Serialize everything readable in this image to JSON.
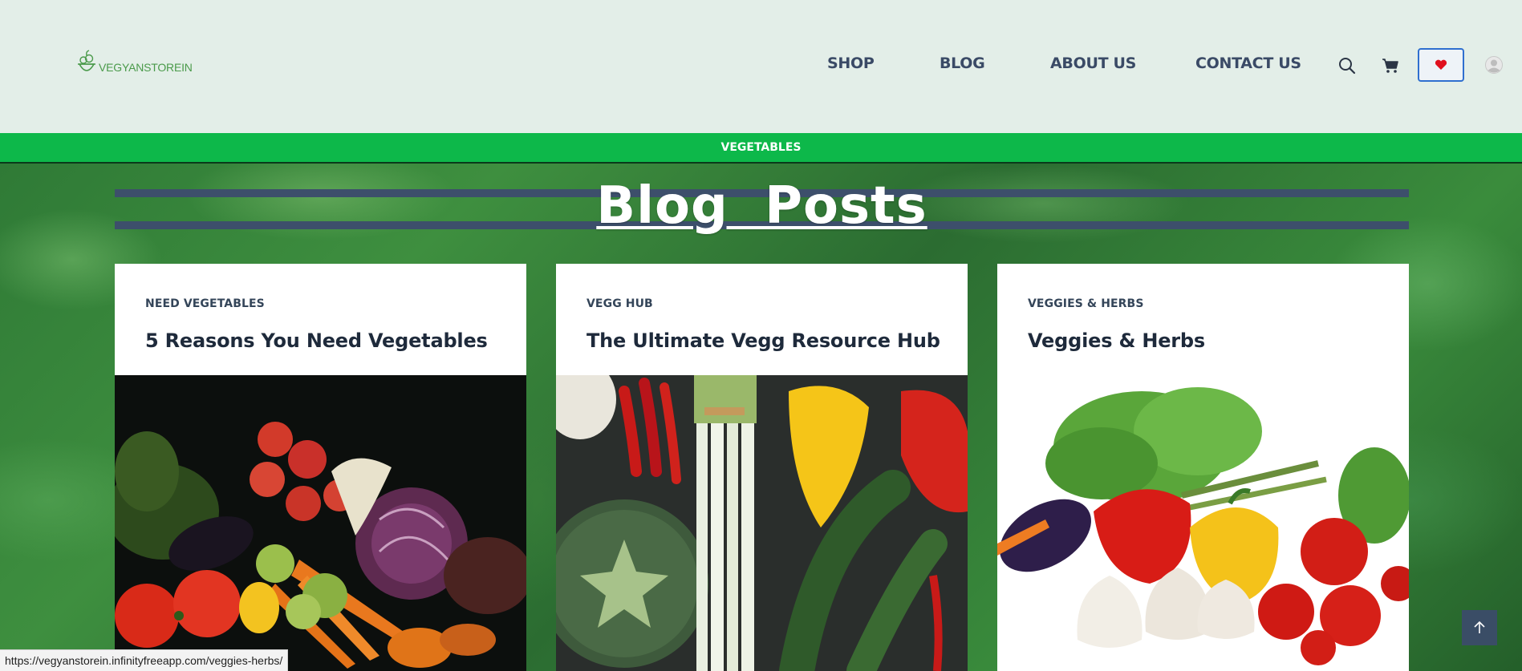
{
  "header": {
    "logo_text": "VEGYANSTOREIN",
    "nav": [
      {
        "label": "SHOP"
      },
      {
        "label": "BLOG"
      },
      {
        "label": "ABOUT US"
      },
      {
        "label": "CONTACT US"
      }
    ],
    "icons": [
      "search-icon",
      "cart-icon",
      "heart-icon",
      "user-avatar-icon"
    ]
  },
  "category_bar": {
    "label": "VEGETABLES"
  },
  "hero": {
    "title": "Blog  Posts"
  },
  "cards": [
    {
      "category": "NEED VEGETABLES",
      "title": "5 Reasons You Need Vegetables",
      "image": "vegetables-still-life-image"
    },
    {
      "category": "VEGG HUB",
      "title": "The Ultimate Vegg Resource Hub",
      "image": "vegetables-flatlay-image"
    },
    {
      "category": "VEGGIES & HERBS",
      "title": "Veggies & Herbs",
      "image": "veggies-herbs-image"
    }
  ],
  "status_bar": {
    "url": "https://vegyanstorein.infinityfreeapp.com/veggies-herbs/"
  },
  "colors": {
    "header_bg": "#e3eee8",
    "nav_text": "#3a4a66",
    "category_bar": "#0db84a",
    "title_bar": "#3d4f6b",
    "accent_blue": "#2f6fcf",
    "heart_red": "#e0101e"
  }
}
